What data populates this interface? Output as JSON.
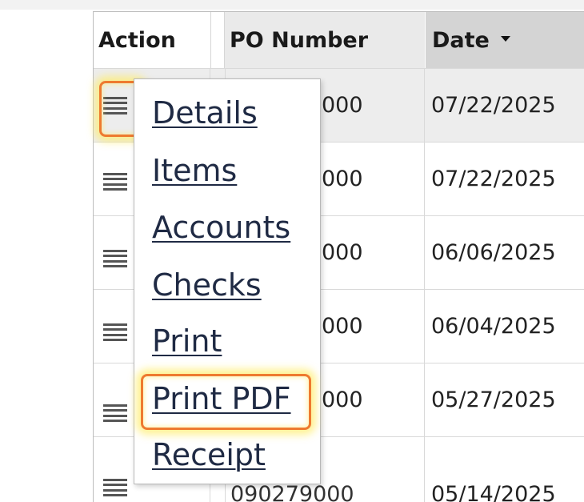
{
  "table": {
    "headers": {
      "action": "Action",
      "po_number": "PO Number",
      "date": "Date"
    },
    "rows": [
      {
        "po_visible": "000",
        "date": "07/22/2025"
      },
      {
        "po_visible": "000",
        "date": "07/22/2025"
      },
      {
        "po_visible": "000",
        "date": "06/06/2025"
      },
      {
        "po_visible": "000",
        "date": "06/04/2025"
      },
      {
        "po_visible": "000",
        "date": "05/27/2025"
      },
      {
        "po_visible": "090279000",
        "date": "05/14/2025"
      }
    ]
  },
  "action_menu": {
    "items": [
      "Details",
      "Items",
      "Accounts",
      "Checks",
      "Print",
      "Print PDF",
      "Receipt"
    ]
  },
  "icons": {
    "row_action": "hamburger-menu-icon",
    "sort": "sort-descending-icon"
  },
  "colors": {
    "highlight_border": "#ee7a2f",
    "highlight_glow": "#ffec64",
    "link": "#1f2a44",
    "selected_row": "#ededed",
    "sorted_header": "#d4d4d4"
  }
}
